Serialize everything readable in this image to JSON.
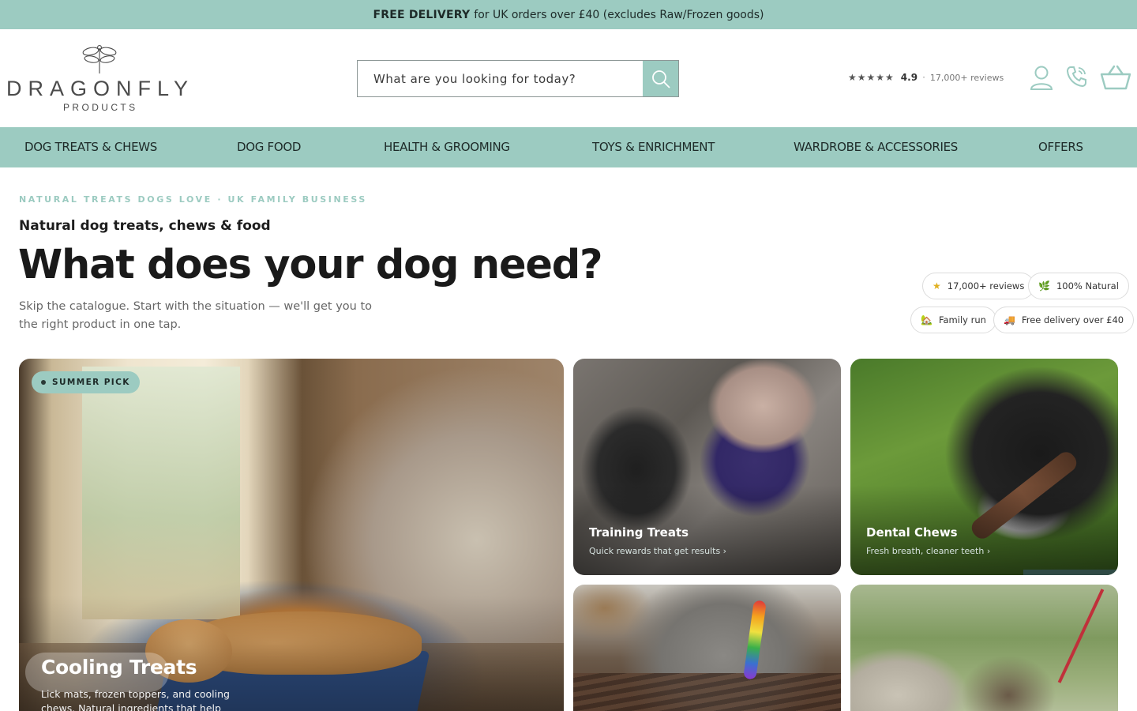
{
  "announcement": {
    "bold": "FREE DELIVERY",
    "text": "for UK orders over £40 (excludes Raw/Frozen goods)"
  },
  "logo": {
    "word": "DRAGONFLY",
    "sub": "PRODUCTS"
  },
  "search": {
    "placeholder": "What are you looking for today?"
  },
  "rating": {
    "stars": "★★★★★",
    "score": "4.9",
    "separator": "·",
    "count": "17,000+ reviews"
  },
  "nav": {
    "items": [
      "DOG TREATS & CHEWS",
      "DOG FOOD",
      "HEALTH & GROOMING",
      "TOYS & ENRICHMENT",
      "WARDROBE & ACCESSORIES",
      "OFFERS"
    ]
  },
  "hero": {
    "eyebrow": "NATURAL TREATS DOGS LOVE · UK FAMILY BUSINESS",
    "kicker": "Natural dog treats, chews & food",
    "headline": "What does your dog need?",
    "lede": "Skip the catalogue. Start with the situation — we'll get you to the right product in one tap."
  },
  "trust_chips": [
    {
      "icon": "★",
      "label": "17,000+ reviews"
    },
    {
      "icon": "🌿",
      "label": "100% Natural"
    },
    {
      "icon": "🏡",
      "label": "Family run"
    },
    {
      "icon": "🚚",
      "label": "Free delivery over £40"
    }
  ],
  "cards": {
    "featured": {
      "badge": "SUMMER PICK",
      "title": "Cooling Treats",
      "subtitle": "Lick mats, frozen toppers, and cooling chews. Natural ingredients that help your"
    },
    "training": {
      "title": "Training Treats",
      "subtitle": "Quick rewards that get results ›"
    },
    "dental": {
      "title": "Dental Chews",
      "subtitle": "Fresh breath, cleaner teeth ›"
    }
  },
  "colors": {
    "brand_teal": "#9ccbc1",
    "text_dark": "#1a1a1a",
    "muted": "#666666"
  }
}
